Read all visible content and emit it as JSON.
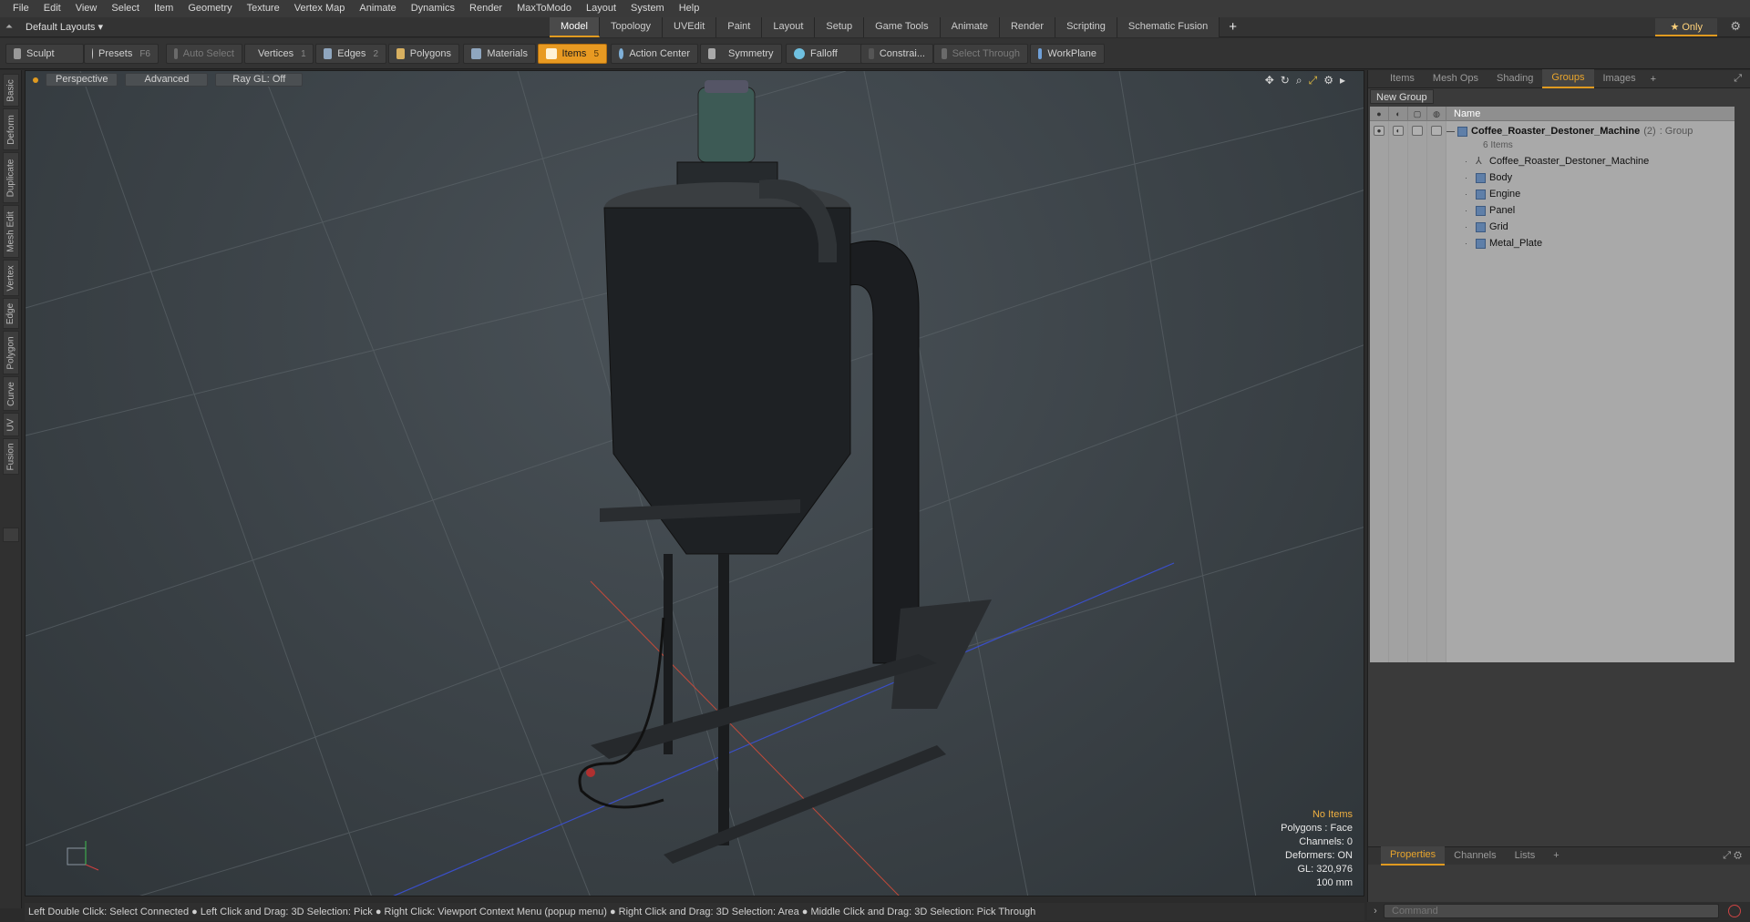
{
  "menu": [
    "File",
    "Edit",
    "View",
    "Select",
    "Item",
    "Geometry",
    "Texture",
    "Vertex Map",
    "Animate",
    "Dynamics",
    "Render",
    "MaxToModo",
    "Layout",
    "System",
    "Help"
  ],
  "layout_select": "Default Layouts ▾",
  "layout_tabs": [
    "Model",
    "Topology",
    "UVEdit",
    "Paint",
    "Layout",
    "Setup",
    "Game Tools",
    "Animate",
    "Render",
    "Scripting",
    "Schematic Fusion"
  ],
  "layout_plus": "+",
  "only_label": "★  Only",
  "toolbar": {
    "sculpt": "Sculpt",
    "presets": "Presets",
    "presets_key": "F6",
    "auto_select": "Auto Select",
    "vertices": "Vertices",
    "vertices_key": "1",
    "edges": "Edges",
    "edges_key": "2",
    "polygons": "Polygons",
    "materials": "Materials",
    "items": "Items",
    "items_key": "5",
    "action_center": "Action Center",
    "symmetry": "Symmetry",
    "falloff": "Falloff",
    "constraints": "Constrai...",
    "select_through": "Select Through",
    "workplane": "WorkPlane"
  },
  "left_tabs": [
    "Basic",
    "Deform",
    "Duplicate",
    "Mesh Edit",
    "Vertex",
    "Edge",
    "Polygon",
    "Curve",
    "UV",
    "Fusion"
  ],
  "viewport": {
    "view": "Perspective",
    "shading": "Advanced",
    "raygl": "Ray GL: Off",
    "stats": {
      "selection": "No Items",
      "polygons": "Polygons : Face",
      "channels": "Channels: 0",
      "deformers": "Deformers: ON",
      "gl": "GL: 320,976",
      "unit": "100 mm"
    }
  },
  "panel_tabs": [
    "Items",
    "Mesh Ops",
    "Shading",
    "Groups",
    "Images"
  ],
  "panel_active": "Groups",
  "new_group": "New Group",
  "tree": {
    "name_header": "Name",
    "group_name": "Coffee_Roaster_Destoner_Machine",
    "group_count": "(2)",
    "group_type": ": Group",
    "group_items": "6 Items",
    "children": [
      "Coffee_Roaster_Destoner_Machine",
      "Body",
      "Engine",
      "Panel",
      "Grid",
      "Metal_Plate"
    ]
  },
  "bottom_tabs": [
    "Properties",
    "Channels",
    "Lists"
  ],
  "command_placeholder": "Command",
  "status": "Left Double Click: Select Connected ● Left Click and Drag: 3D Selection: Pick ● Right Click: Viewport Context Menu (popup menu) ● Right Click and Drag: 3D Selection: Area ● Middle Click and Drag: 3D Selection: Pick Through",
  "colors": {
    "accent": "#e89a22",
    "viewport_bg": "#3b4247"
  }
}
